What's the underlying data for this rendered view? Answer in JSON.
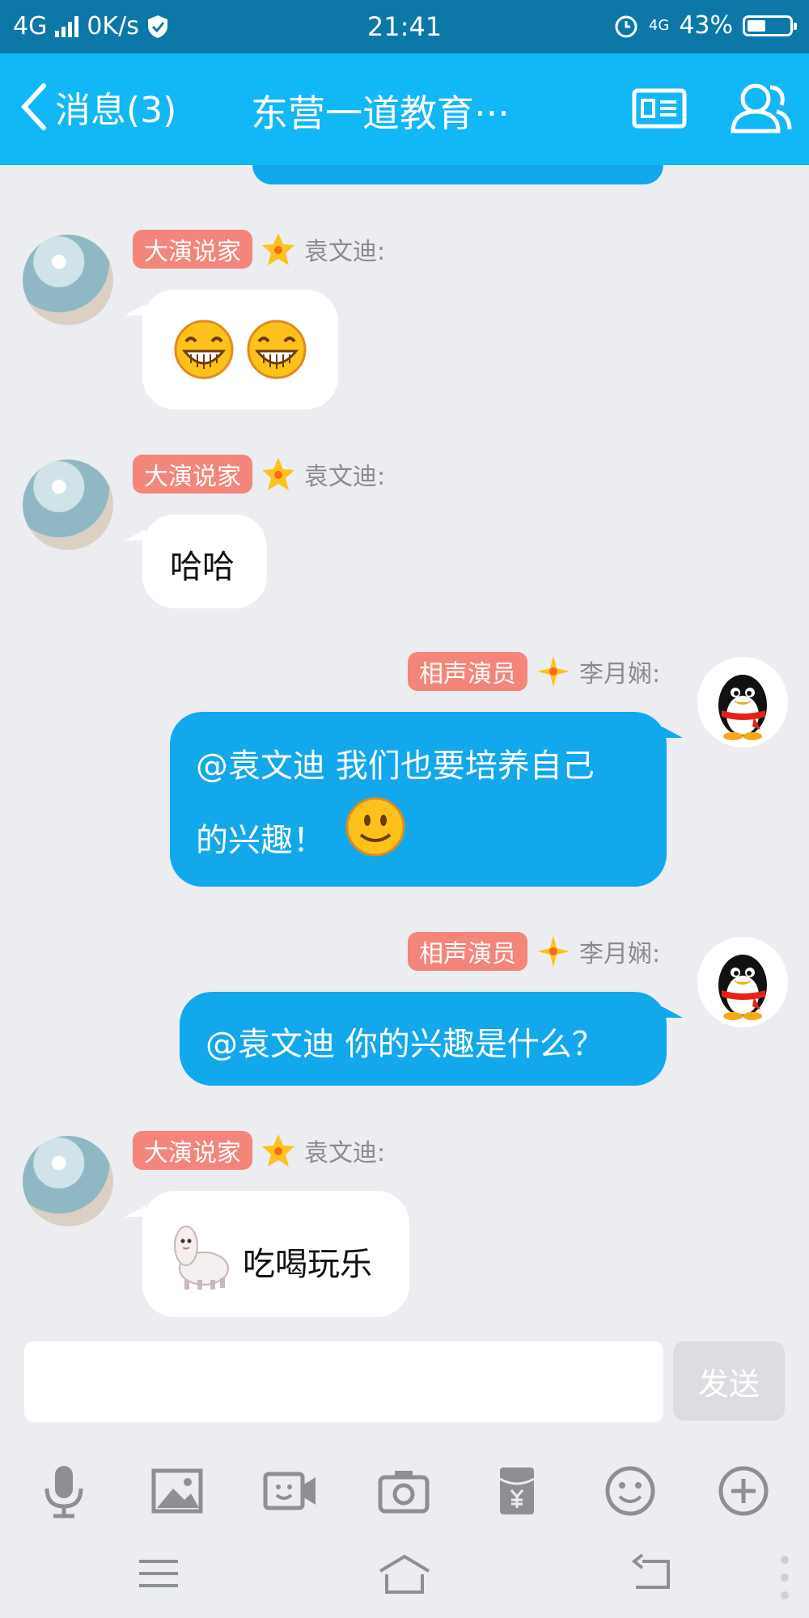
{
  "status_bar": {
    "network": "4G",
    "speed": "0K/s",
    "time": "21:41",
    "network_right": "4G",
    "battery_percent": "43%",
    "battery_level": 0.43
  },
  "header": {
    "back_label": "消息(3)",
    "title": "东营一道教育···"
  },
  "messages": [
    {
      "badge": "大演说家",
      "sender": "袁文迪:",
      "text": ""
    },
    {
      "badge": "大演说家",
      "sender": "袁文迪:",
      "text": "哈哈"
    },
    {
      "badge": "相声演员",
      "sender": "李月娴:",
      "line1": "@袁文迪 我们也要培养自己",
      "line2": "的兴趣！"
    },
    {
      "badge": "相声演员",
      "sender": "李月娴:",
      "text": "@袁文迪 你的兴趣是什么？"
    },
    {
      "badge": "大演说家",
      "sender": "袁文迪:",
      "text": "吃喝玩乐"
    }
  ],
  "composer": {
    "placeholder": "",
    "send_label": "发送"
  },
  "colors": {
    "accent": "#12b7f5",
    "bubble_out": "#12a8eb",
    "badge": "#f4857a",
    "status_bar": "#0d78a8"
  },
  "toolbar_icons": [
    "microphone-icon",
    "image-icon",
    "video-icon",
    "camera-icon",
    "red-packet-icon",
    "emoji-icon",
    "plus-icon"
  ]
}
